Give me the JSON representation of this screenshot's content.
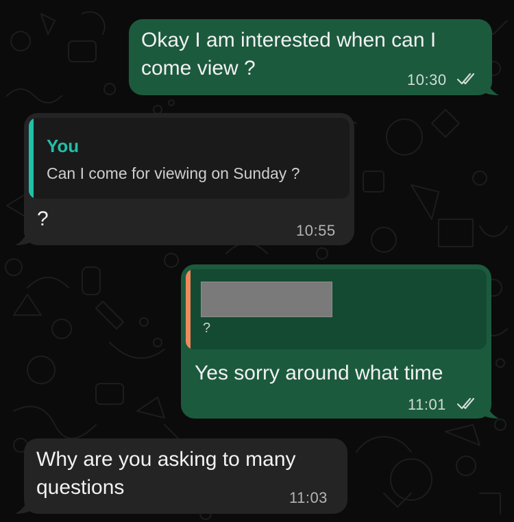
{
  "colors": {
    "background": "#0b0b0b",
    "outgoing_bubble": "#1c5a3e",
    "incoming_bubble": "#242424",
    "quote_bar_self": "#21c0a8",
    "quote_bar_other": "#f08a5d",
    "read_ticks": "#d3ddd7",
    "redaction": "#7a7a7a"
  },
  "messages": [
    {
      "direction": "outgoing",
      "text": "Okay I am interested when can I\ncome view ?",
      "time": "10:30",
      "status_icon": "double-check-icon"
    },
    {
      "direction": "incoming",
      "quoted": {
        "author": "You",
        "text": "Can I come for viewing on Sunday ?"
      },
      "text": "?",
      "time": "10:55"
    },
    {
      "direction": "outgoing",
      "quoted": {
        "author_redacted": true,
        "text": "?"
      },
      "text": "Yes sorry around what time",
      "time": "11:01",
      "status_icon": "double-check-icon"
    },
    {
      "direction": "incoming",
      "text": "Why are you asking to many\nquestions",
      "time": "11:03"
    }
  ]
}
